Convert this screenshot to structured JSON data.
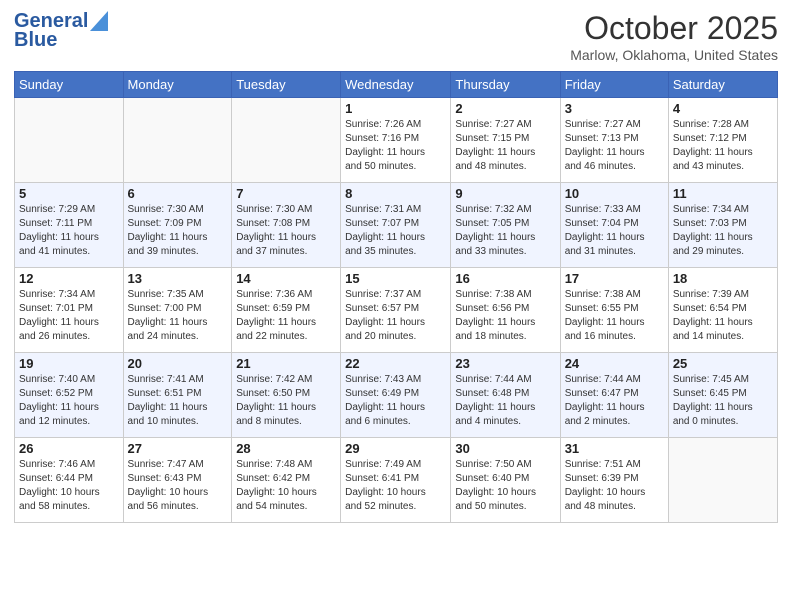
{
  "header": {
    "logo_line1": "General",
    "logo_line2": "Blue",
    "month": "October 2025",
    "location": "Marlow, Oklahoma, United States"
  },
  "weekdays": [
    "Sunday",
    "Monday",
    "Tuesday",
    "Wednesday",
    "Thursday",
    "Friday",
    "Saturday"
  ],
  "weeks": [
    [
      {
        "day": "",
        "info": ""
      },
      {
        "day": "",
        "info": ""
      },
      {
        "day": "",
        "info": ""
      },
      {
        "day": "1",
        "info": "Sunrise: 7:26 AM\nSunset: 7:16 PM\nDaylight: 11 hours\nand 50 minutes."
      },
      {
        "day": "2",
        "info": "Sunrise: 7:27 AM\nSunset: 7:15 PM\nDaylight: 11 hours\nand 48 minutes."
      },
      {
        "day": "3",
        "info": "Sunrise: 7:27 AM\nSunset: 7:13 PM\nDaylight: 11 hours\nand 46 minutes."
      },
      {
        "day": "4",
        "info": "Sunrise: 7:28 AM\nSunset: 7:12 PM\nDaylight: 11 hours\nand 43 minutes."
      }
    ],
    [
      {
        "day": "5",
        "info": "Sunrise: 7:29 AM\nSunset: 7:11 PM\nDaylight: 11 hours\nand 41 minutes."
      },
      {
        "day": "6",
        "info": "Sunrise: 7:30 AM\nSunset: 7:09 PM\nDaylight: 11 hours\nand 39 minutes."
      },
      {
        "day": "7",
        "info": "Sunrise: 7:30 AM\nSunset: 7:08 PM\nDaylight: 11 hours\nand 37 minutes."
      },
      {
        "day": "8",
        "info": "Sunrise: 7:31 AM\nSunset: 7:07 PM\nDaylight: 11 hours\nand 35 minutes."
      },
      {
        "day": "9",
        "info": "Sunrise: 7:32 AM\nSunset: 7:05 PM\nDaylight: 11 hours\nand 33 minutes."
      },
      {
        "day": "10",
        "info": "Sunrise: 7:33 AM\nSunset: 7:04 PM\nDaylight: 11 hours\nand 31 minutes."
      },
      {
        "day": "11",
        "info": "Sunrise: 7:34 AM\nSunset: 7:03 PM\nDaylight: 11 hours\nand 29 minutes."
      }
    ],
    [
      {
        "day": "12",
        "info": "Sunrise: 7:34 AM\nSunset: 7:01 PM\nDaylight: 11 hours\nand 26 minutes."
      },
      {
        "day": "13",
        "info": "Sunrise: 7:35 AM\nSunset: 7:00 PM\nDaylight: 11 hours\nand 24 minutes."
      },
      {
        "day": "14",
        "info": "Sunrise: 7:36 AM\nSunset: 6:59 PM\nDaylight: 11 hours\nand 22 minutes."
      },
      {
        "day": "15",
        "info": "Sunrise: 7:37 AM\nSunset: 6:57 PM\nDaylight: 11 hours\nand 20 minutes."
      },
      {
        "day": "16",
        "info": "Sunrise: 7:38 AM\nSunset: 6:56 PM\nDaylight: 11 hours\nand 18 minutes."
      },
      {
        "day": "17",
        "info": "Sunrise: 7:38 AM\nSunset: 6:55 PM\nDaylight: 11 hours\nand 16 minutes."
      },
      {
        "day": "18",
        "info": "Sunrise: 7:39 AM\nSunset: 6:54 PM\nDaylight: 11 hours\nand 14 minutes."
      }
    ],
    [
      {
        "day": "19",
        "info": "Sunrise: 7:40 AM\nSunset: 6:52 PM\nDaylight: 11 hours\nand 12 minutes."
      },
      {
        "day": "20",
        "info": "Sunrise: 7:41 AM\nSunset: 6:51 PM\nDaylight: 11 hours\nand 10 minutes."
      },
      {
        "day": "21",
        "info": "Sunrise: 7:42 AM\nSunset: 6:50 PM\nDaylight: 11 hours\nand 8 minutes."
      },
      {
        "day": "22",
        "info": "Sunrise: 7:43 AM\nSunset: 6:49 PM\nDaylight: 11 hours\nand 6 minutes."
      },
      {
        "day": "23",
        "info": "Sunrise: 7:44 AM\nSunset: 6:48 PM\nDaylight: 11 hours\nand 4 minutes."
      },
      {
        "day": "24",
        "info": "Sunrise: 7:44 AM\nSunset: 6:47 PM\nDaylight: 11 hours\nand 2 minutes."
      },
      {
        "day": "25",
        "info": "Sunrise: 7:45 AM\nSunset: 6:45 PM\nDaylight: 11 hours\nand 0 minutes."
      }
    ],
    [
      {
        "day": "26",
        "info": "Sunrise: 7:46 AM\nSunset: 6:44 PM\nDaylight: 10 hours\nand 58 minutes."
      },
      {
        "day": "27",
        "info": "Sunrise: 7:47 AM\nSunset: 6:43 PM\nDaylight: 10 hours\nand 56 minutes."
      },
      {
        "day": "28",
        "info": "Sunrise: 7:48 AM\nSunset: 6:42 PM\nDaylight: 10 hours\nand 54 minutes."
      },
      {
        "day": "29",
        "info": "Sunrise: 7:49 AM\nSunset: 6:41 PM\nDaylight: 10 hours\nand 52 minutes."
      },
      {
        "day": "30",
        "info": "Sunrise: 7:50 AM\nSunset: 6:40 PM\nDaylight: 10 hours\nand 50 minutes."
      },
      {
        "day": "31",
        "info": "Sunrise: 7:51 AM\nSunset: 6:39 PM\nDaylight: 10 hours\nand 48 minutes."
      },
      {
        "day": "",
        "info": ""
      }
    ]
  ]
}
